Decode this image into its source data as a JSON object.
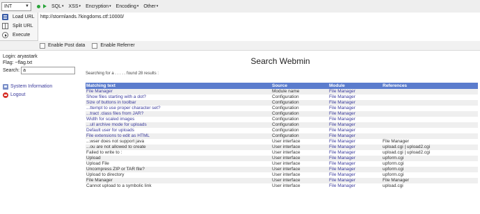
{
  "hackbar": {
    "select_value": "INT",
    "menus": [
      {
        "label": "SQL"
      },
      {
        "label": "XSS"
      },
      {
        "label": "Encryption"
      },
      {
        "label": "Encoding"
      },
      {
        "label": "Other"
      }
    ],
    "buttons": {
      "load_url": "Load URL",
      "split_url": "Split URL",
      "execute": "Execute"
    },
    "url": "http://stormlands.7kingdoms.ctf:10000/",
    "options": {
      "post_data": "Enable Post data",
      "referrer": "Enable Referrer"
    }
  },
  "sidebar": {
    "login": "Login: aryastark",
    "flag": "Flag: ~flag.txt",
    "search_label": "Search:",
    "search_value": "a",
    "links": {
      "system_information": "System Information",
      "logout": "Logout"
    }
  },
  "main": {
    "title": "Search Webmin",
    "searching_text": "Searching for a . . . . . found 28 results :",
    "columns": [
      "Matching text",
      "Source",
      "Module",
      "References"
    ],
    "rows": [
      {
        "text": "File Manager",
        "source": "Module name",
        "module": "File Manager",
        "refs": "",
        "text_link": true
      },
      {
        "text": "Show files starting with a dot?",
        "source": "Configuration",
        "module": "File Manager",
        "refs": "",
        "text_link": true
      },
      {
        "text": "Size of buttons in toolbar",
        "source": "Configuration",
        "module": "File Manager",
        "refs": "",
        "text_link": true
      },
      {
        "text": "...ttempt to use proper character set?",
        "source": "Configuration",
        "module": "File Manager",
        "refs": "",
        "text_link": true
      },
      {
        "text": "...tract .class files from JAR?",
        "source": "Configuration",
        "module": "File Manager",
        "refs": "",
        "text_link": true
      },
      {
        "text": "Width for scaled images",
        "source": "Configuration",
        "module": "File Manager",
        "refs": "",
        "text_link": true
      },
      {
        "text": "...ull archive mode for uploads",
        "source": "Configuration",
        "module": "File Manager",
        "refs": "",
        "text_link": true
      },
      {
        "text": "Default user for uploads",
        "source": "Configuration",
        "module": "File Manager",
        "refs": "",
        "text_link": true
      },
      {
        "text": "File extensions to edit as HTML",
        "source": "Configuration",
        "module": "File Manager",
        "refs": "",
        "text_link": true
      },
      {
        "text": "...wser does not support java",
        "source": "User interface",
        "module": "File Manager",
        "refs": "File Manager",
        "text_link": false
      },
      {
        "text": "...ou are not allowed to create",
        "source": "User interface",
        "module": "File Manager",
        "refs": "upload.cgi | upload2.cgi",
        "text_link": false
      },
      {
        "text": "Failed to write to :",
        "source": "User interface",
        "module": "File Manager",
        "refs": "upload.cgi | upload2.cgi",
        "text_link": false
      },
      {
        "text": "Upload",
        "source": "User interface",
        "module": "File Manager",
        "refs": "upform.cgi",
        "text_link": false
      },
      {
        "text": "Upload File",
        "source": "User interface",
        "module": "File Manager",
        "refs": "upform.cgi",
        "text_link": false
      },
      {
        "text": "Uncompress ZIP or TAR file?",
        "source": "User interface",
        "module": "File Manager",
        "refs": "upform.cgi",
        "text_link": false
      },
      {
        "text": "Upload to directory",
        "source": "User interface",
        "module": "File Manager",
        "refs": "upform.cgi",
        "text_link": false
      },
      {
        "text": "File Manager",
        "source": "User interface",
        "module": "File Manager",
        "refs": "File Manager",
        "text_link": false
      },
      {
        "text": "Cannot upload to a symbolic link",
        "source": "User interface",
        "module": "File Manager",
        "refs": "upload.cgi",
        "text_link": false
      }
    ]
  },
  "colors": {
    "table_header": "#5b7ccd",
    "link": "#3b3b9c",
    "hackbar_green": "#2aa43a"
  }
}
